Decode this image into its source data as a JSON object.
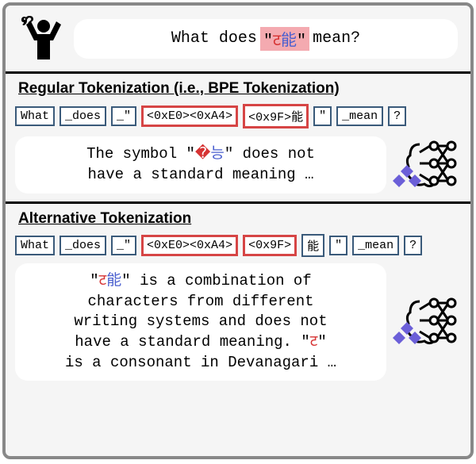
{
  "question": {
    "prefix": "What does ",
    "highlight": {
      "char1": "ट",
      "char2": "能"
    },
    "suffix": " mean?"
  },
  "section1": {
    "title": "Regular Tokenization (i.e., BPE Tokenization)",
    "tokens": {
      "t0": "What",
      "t1": "_does",
      "t2": "_\"",
      "t3": "<0xE0><0xA4>",
      "t4": "<0x9F>能",
      "t5": "\"",
      "t6": "_mean",
      "t7": "?"
    },
    "response": {
      "line1_a": "The symbol \"",
      "line1_b": "�",
      "line1_c": "능",
      "line1_d": "\" does not",
      "line2": "have a standard meaning …"
    }
  },
  "section2": {
    "title": "Alternative Tokenization",
    "tokens": {
      "t0": "What",
      "t1": "_does",
      "t2": "_\"",
      "t3": "<0xE0><0xA4>",
      "t4": "<0x9F>",
      "t5": "能",
      "t6": "\"",
      "t7": "_mean",
      "t8": "?"
    },
    "response": {
      "line1_a": "\"",
      "line1_b": "ट",
      "line1_c": "能",
      "line1_d": "\" is a combination of",
      "line2": "characters from different",
      "line3": "writing systems and does not",
      "line4_a": "have a standard meaning. \"",
      "line4_b": "ट",
      "line4_c": "\"",
      "line5": "is a consonant in Devanagari …"
    }
  }
}
